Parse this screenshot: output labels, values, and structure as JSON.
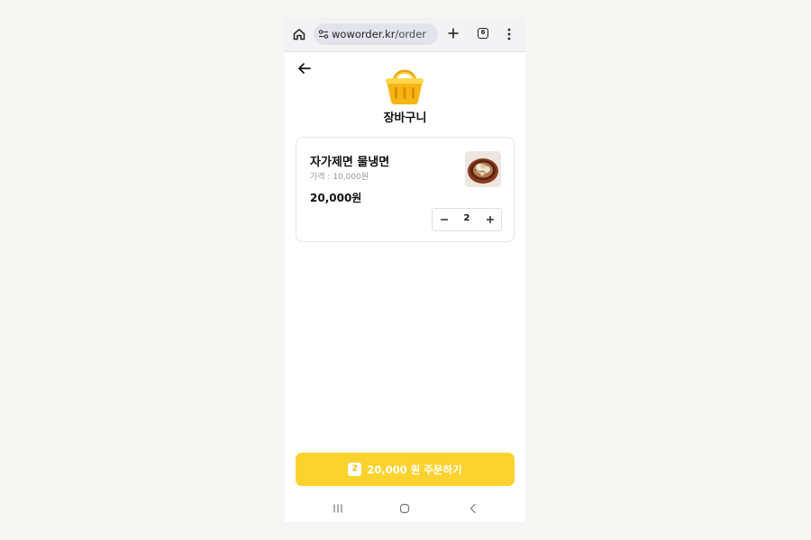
{
  "browser": {
    "url_domain": "woworder.kr",
    "url_path": "/order",
    "tab_count": "6",
    "icons": [
      "home-icon",
      "site-settings-icon",
      "plus-icon",
      "tabs-icon",
      "more-vert-icon"
    ]
  },
  "header": {
    "title": "장바구니",
    "icons": [
      "back-arrow-icon",
      "basket-icon"
    ]
  },
  "cart": {
    "items": [
      {
        "name": "자가제면 물냉면",
        "price_label": "가격 : 10,000원",
        "total": "20,000원",
        "quantity": "2"
      }
    ]
  },
  "order_button": {
    "count": "2",
    "label": "20,000 원 주문하기"
  },
  "nav": {
    "icons": [
      "recents-icon",
      "home-icon",
      "back-icon"
    ]
  },
  "colors": {
    "accent": "#fcd22e",
    "page_background": "#f6f6f4"
  }
}
